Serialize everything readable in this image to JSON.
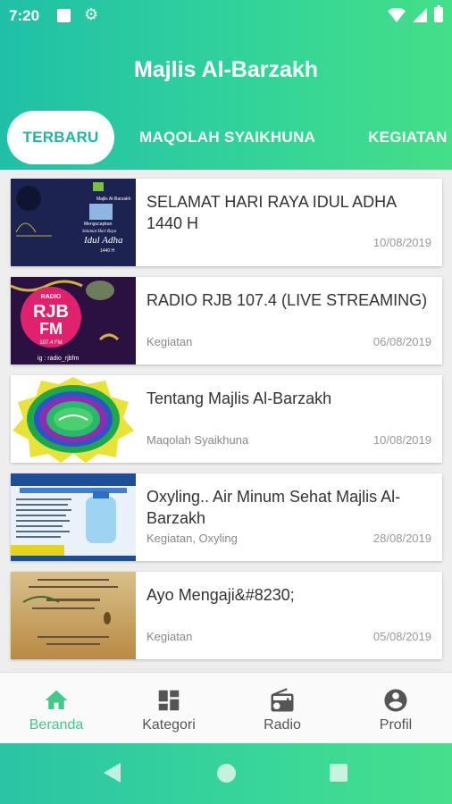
{
  "status": {
    "time": "7:20"
  },
  "app": {
    "title": "Majlis Al-Barzakh"
  },
  "tabs": [
    "TERBARU",
    "MAQOLAH SYAIKHUNA",
    "KEGIATAN"
  ],
  "posts": [
    {
      "title": "SELAMAT HARI RAYA IDUL ADHA 1440 H",
      "category": "",
      "date": "10/08/2019",
      "thumb": {
        "title": "Majlis Al-Barzakh",
        "line1": "Mengucapkan",
        "line2": "Selamat Hari Raya",
        "line3": "Idul Adha",
        "line4": "1440 H"
      }
    },
    {
      "title": "RADIO RJB 107.4 (LIVE STREAMING)",
      "category": "Kegiatan",
      "date": "06/08/2019",
      "thumb": {
        "top": "RADIO",
        "main1": "RJB",
        "main2": "FM",
        "freq": "107.4 FM",
        "ig": "ig : radio_rjbfm"
      }
    },
    {
      "title": "Tentang Majlis Al-Barzakh",
      "category": "Maqolah Syaikhuna",
      "date": "10/08/2019"
    },
    {
      "title": "Oxyling.. Air Minum Sehat Majlis Al-Barzakh",
      "category": "Kegiatan, Oxyling",
      "date": "28/08/2019"
    },
    {
      "title": "Ayo Mengaji&#8230;",
      "category": "Kegiatan",
      "date": "05/08/2019"
    }
  ],
  "nav": [
    {
      "label": "Beranda",
      "icon": "home-icon",
      "active": true
    },
    {
      "label": "Kategori",
      "icon": "dashboard-icon",
      "active": false
    },
    {
      "label": "Radio",
      "icon": "radio-icon",
      "active": false
    },
    {
      "label": "Profil",
      "icon": "account-circle-icon",
      "active": false
    }
  ],
  "colors": {
    "accent": "#3fc98a",
    "header_start": "#1fc0a7",
    "header_end": "#44df88",
    "active_tab_text": "#1fb5a2"
  }
}
